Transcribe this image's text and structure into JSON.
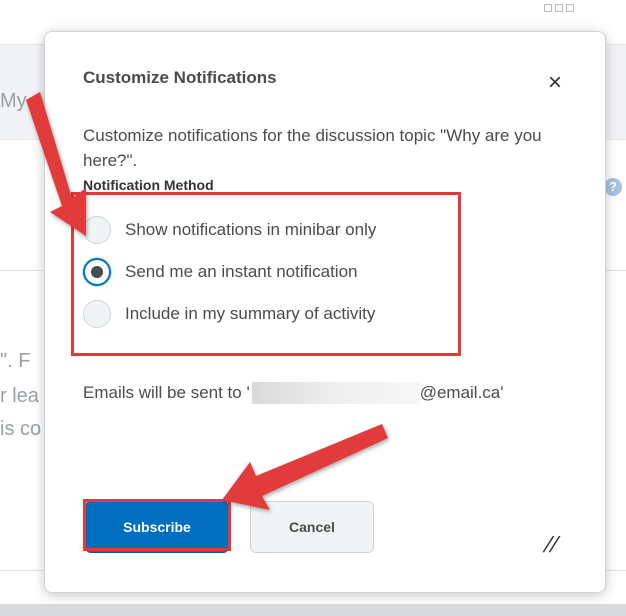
{
  "dialog": {
    "title": "Customize Notifications",
    "close_label": "×",
    "description": "Customize notifications for the discussion topic \"Why are you here?\".",
    "method_label": "Notification Method",
    "options": [
      {
        "label": "Show notifications in minibar only",
        "selected": false
      },
      {
        "label": "Send me an instant notification",
        "selected": true
      },
      {
        "label": "Include in my summary of activity",
        "selected": false
      }
    ],
    "email_prefix": "Emails will be sent to '",
    "email_suffix": "@email.ca'",
    "subscribe_label": "Subscribe",
    "cancel_label": "Cancel"
  },
  "background": {
    "fragment_1": "My",
    "fragment_2": "\". F",
    "fragment_3": "r lea",
    "fragment_4": "is co",
    "help_glyph": "?"
  },
  "colors": {
    "accent": "#006fbf",
    "annotation": "#e23a3a"
  }
}
